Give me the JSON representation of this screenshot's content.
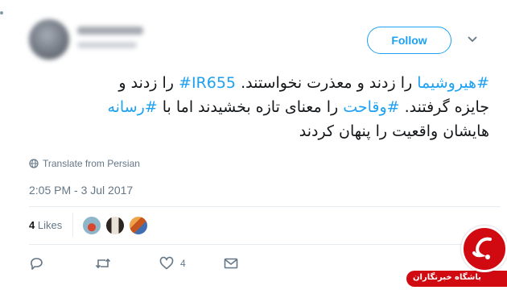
{
  "tweet": {
    "follow_label": "Follow",
    "text_lines": [
      [
        {
          "text": "#هیروشیما",
          "link": true
        },
        {
          "text": " را زدند و معذرت نخواستند. ",
          "link": false
        },
        {
          "text": "#IR655",
          "link": true
        },
        {
          "text": " را زدند و",
          "link": false
        }
      ],
      [
        {
          "text": "جایزه گرفتند. ",
          "link": false
        },
        {
          "text": "#وقاحت",
          "link": true
        },
        {
          "text": " را معنای تازه بخشیدند اما با ",
          "link": false
        },
        {
          "text": "#رسانه",
          "link": true
        }
      ],
      [
        {
          "text": "هایشان واقعیت را پنهان کردند",
          "link": false
        }
      ]
    ],
    "translate_label": "Translate from Persian",
    "timestamp": "2:05 PM - 3 Jul 2017",
    "likes": {
      "count": "4",
      "label": "Likes"
    },
    "like_action_count": "4"
  },
  "watermark": {
    "text": "باشگاه خبرنگاران",
    "color": "#d10a12"
  },
  "icons": {
    "globe": "globe-icon",
    "reply": "reply-icon",
    "retweet": "retweet-icon",
    "like": "heart-icon",
    "dm": "envelope-icon",
    "caret": "chevron-down-icon"
  },
  "colors": {
    "accent": "#1da1f2",
    "muted": "#657786",
    "text": "#14171a"
  }
}
